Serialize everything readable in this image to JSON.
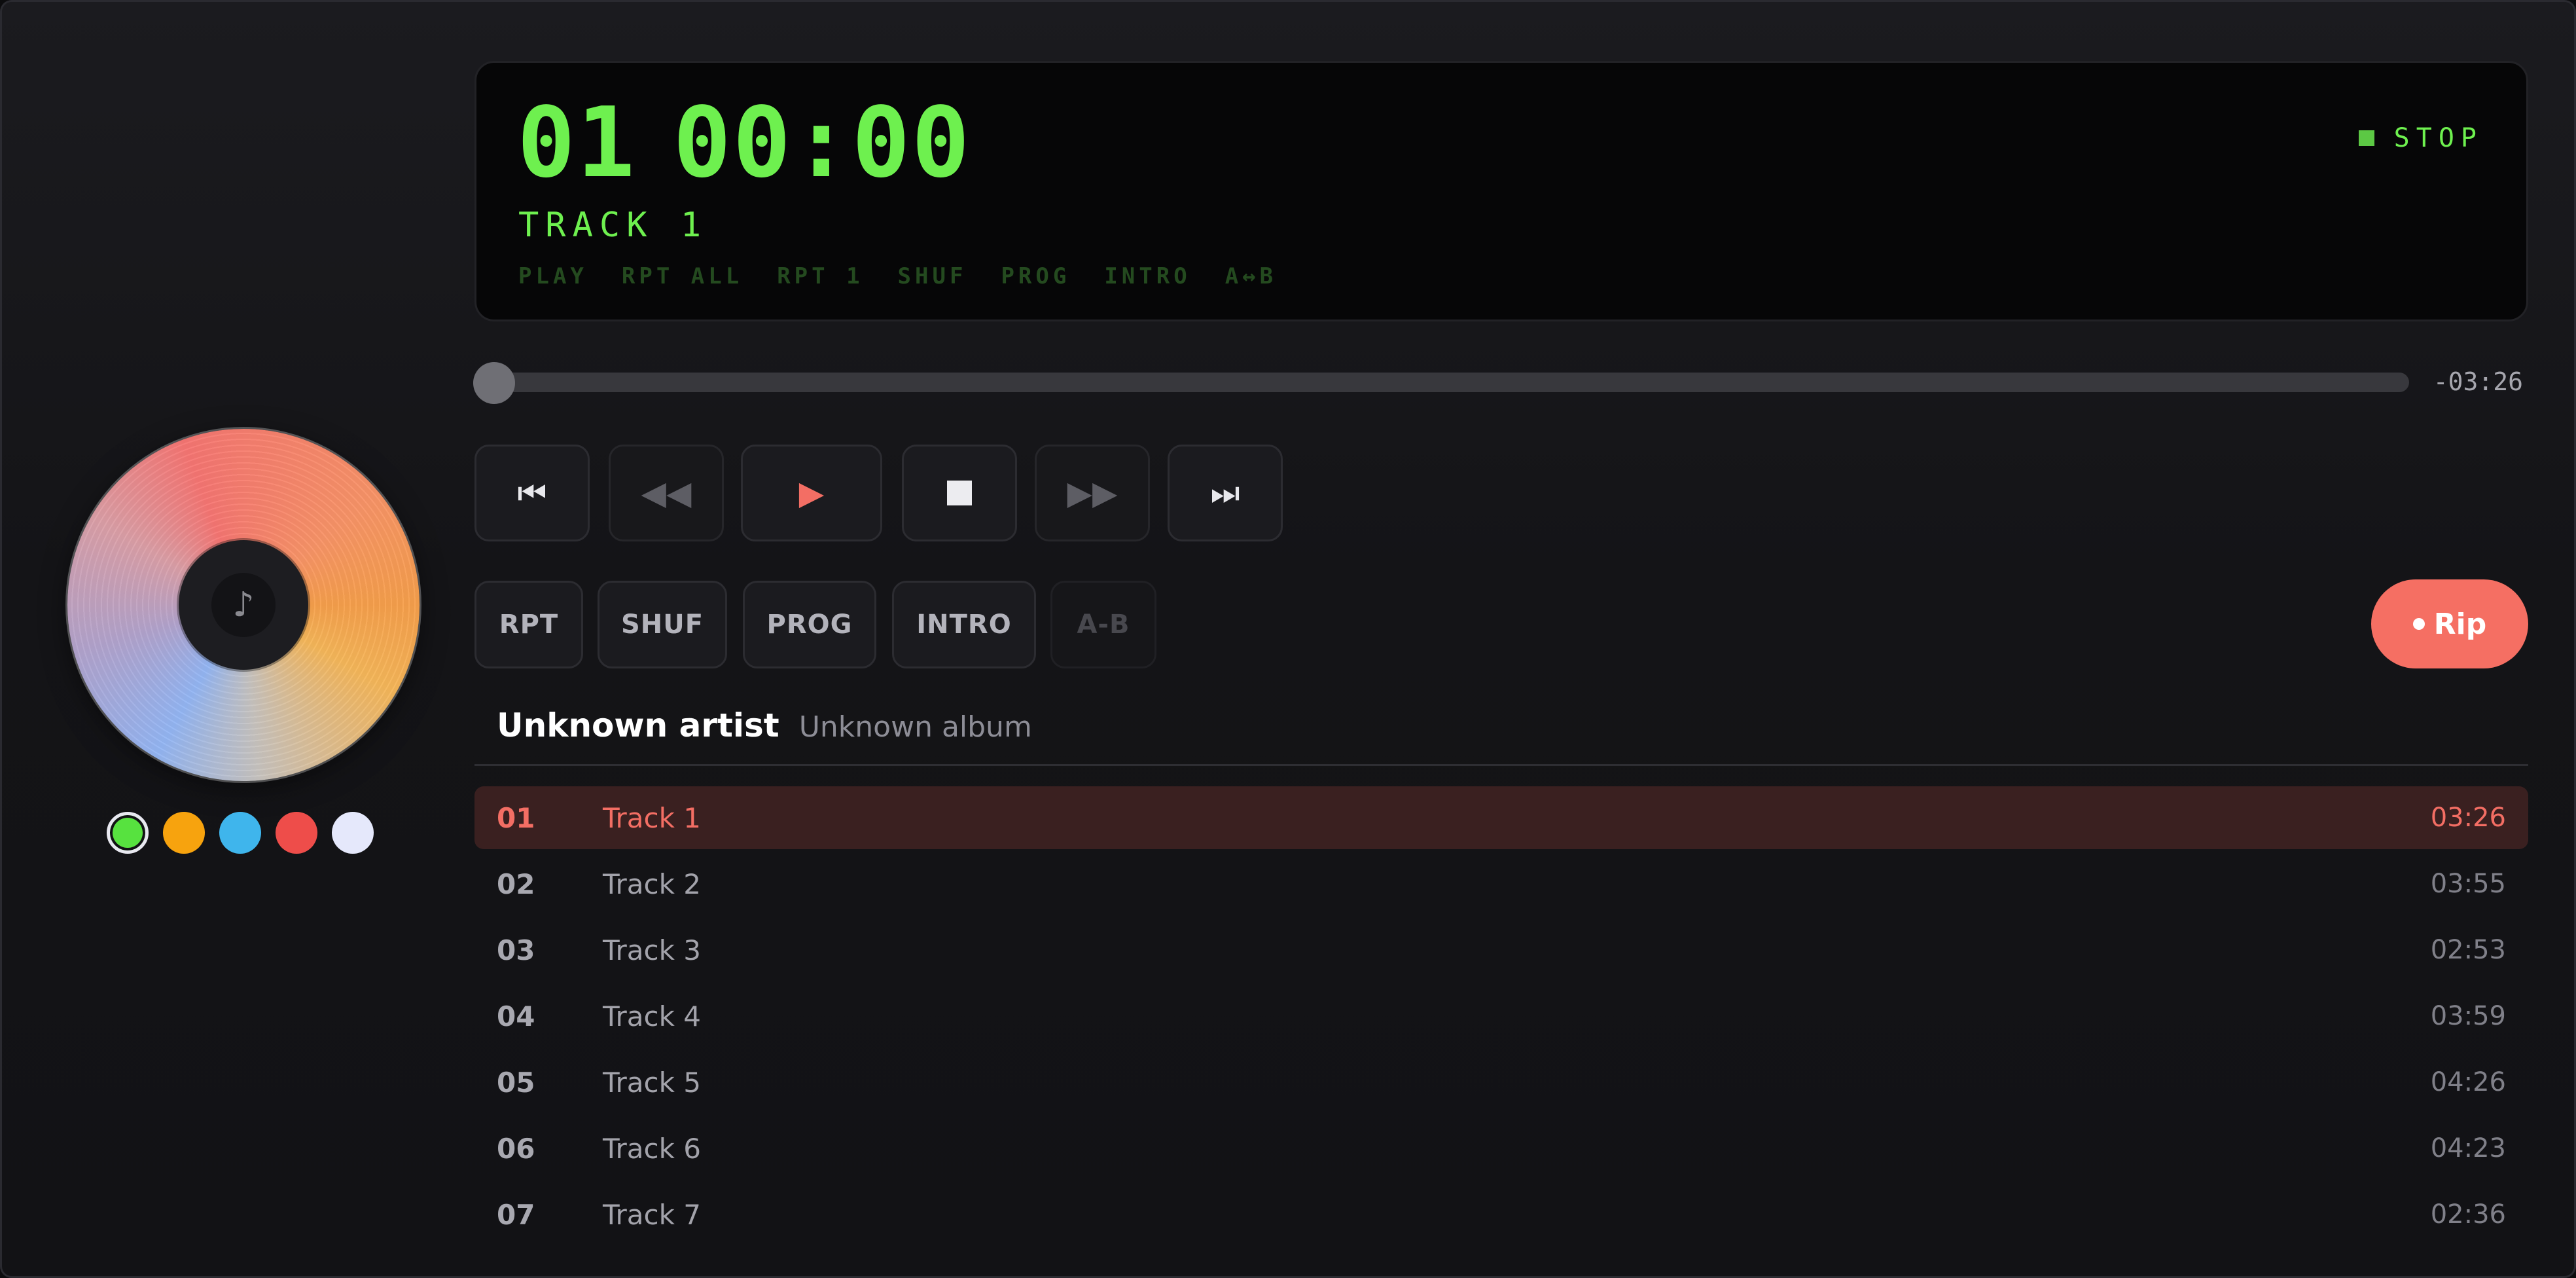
{
  "disc": {
    "center_glyph": "♪"
  },
  "color_swatches": [
    {
      "name": "green",
      "color": "#57e23f",
      "selected": true
    },
    {
      "name": "orange",
      "color": "#f7a30e"
    },
    {
      "name": "cyan",
      "color": "#3fb5ec"
    },
    {
      "name": "red",
      "color": "#ee4d4a"
    },
    {
      "name": "white",
      "color": "#e5e8fb"
    }
  ],
  "display": {
    "track_number": "01",
    "time": "00:00",
    "track_label": "TRACK 1",
    "status_text": "STOP",
    "flags": [
      "PLAY",
      "RPT ALL",
      "RPT 1",
      "SHUF",
      "PROG",
      "INTRO",
      "A↔B"
    ],
    "lcd_color": "#6ef04f"
  },
  "seek": {
    "progress": 0.0,
    "remaining": "-03:26"
  },
  "transport": {
    "prev_icon": "⏮",
    "rewind_icon": "◀◀",
    "play_icon": "▶",
    "stop_icon": "stop-square",
    "forward_icon": "▶▶",
    "next_icon": "⏭"
  },
  "modes": {
    "rpt": "RPT",
    "shuf": "SHUF",
    "prog": "PROG",
    "intro": "INTRO",
    "ab": "A-B"
  },
  "rip_label": "Rip",
  "accent_color": "#f56f63",
  "album": {
    "artist": "Unknown artist",
    "title": "Unknown album"
  },
  "tracks": [
    {
      "num": "01",
      "title": "Track 1",
      "duration": "03:26",
      "active": true
    },
    {
      "num": "02",
      "title": "Track 2",
      "duration": "03:55"
    },
    {
      "num": "03",
      "title": "Track 3",
      "duration": "02:53"
    },
    {
      "num": "04",
      "title": "Track 4",
      "duration": "03:59"
    },
    {
      "num": "05",
      "title": "Track 5",
      "duration": "04:26"
    },
    {
      "num": "06",
      "title": "Track 6",
      "duration": "04:23"
    },
    {
      "num": "07",
      "title": "Track 7",
      "duration": "02:36"
    }
  ]
}
